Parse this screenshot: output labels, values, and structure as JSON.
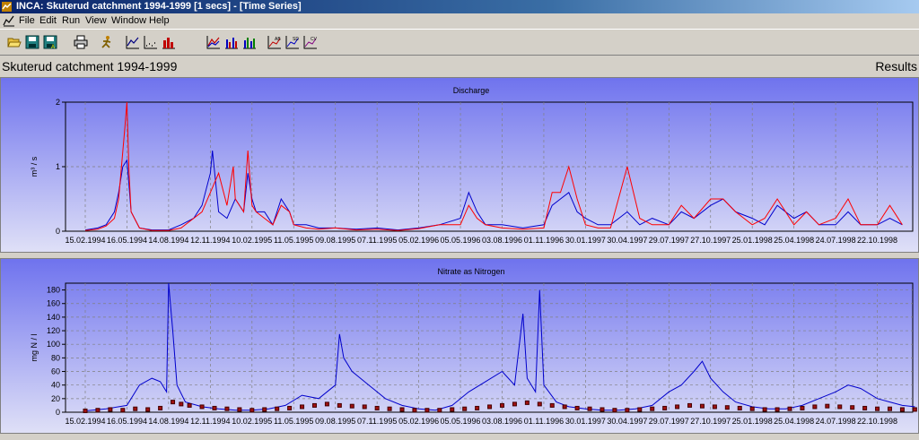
{
  "window": {
    "title": "INCA: Skuterud catchment 1994-1999 [1 secs] - [Time Series]",
    "icon": "inca-app-icon"
  },
  "menu": {
    "items": [
      "File",
      "Edit",
      "Run",
      "View",
      "Window",
      "Help"
    ]
  },
  "toolbar": {
    "buttons": [
      "open-folder-icon",
      "save-icon",
      "save-all-icon",
      "print-icon",
      "run-icon",
      "line-chart-icon",
      "dotted-chart-icon",
      "bar-chart-icon",
      "chart-zoom-icon",
      "chart-bars-icon",
      "chart-bars-color-icon",
      "chart-stats-icon",
      "chart-stats-2-icon",
      "chart-stats-3-icon"
    ]
  },
  "header": {
    "title": "Skuterud catchment 1994-1999",
    "right_label": "Results"
  },
  "colors": {
    "plot_top": "#6f73ee",
    "plot_bottom": "#dfe0f7",
    "series_blue": "#0000cc",
    "series_red": "#ff0000",
    "marker": "#a01010"
  },
  "chart_data": [
    {
      "type": "line",
      "title": "Discharge",
      "ylabel": "m³ / s",
      "xlabel": "",
      "ylim": [
        0,
        2
      ],
      "yticks": [
        "0",
        "1",
        "2"
      ],
      "x_tick_labels": [
        "15.02.1994",
        "16.05.1994",
        "14.08.1994",
        "12.11.1994",
        "10.02.1995",
        "11.05.1995",
        "09.08.1995",
        "07.11.1995",
        "05.02.1996",
        "05.05.1996",
        "03.08.1996",
        "01.11.1996",
        "30.01.1997",
        "30.04.1997",
        "29.07.1997",
        "27.10.1997",
        "25.01.1998",
        "25.04.1998",
        "24.07.1998",
        "22.10.1998"
      ],
      "grid": true,
      "series": [
        {
          "color": "blue",
          "x_index": [
            0,
            0.3,
            0.5,
            0.7,
            0.8,
            0.9,
            1.0,
            1.05,
            1.1,
            1.3,
            1.6,
            2.0,
            2.3,
            2.6,
            2.8,
            3.0,
            3.05,
            3.2,
            3.4,
            3.6,
            3.8,
            3.9,
            4.0,
            4.1,
            4.3,
            4.5,
            4.7,
            4.9,
            5.0,
            5.3,
            5.6,
            6.0,
            6.5,
            7.0,
            7.5,
            8.0,
            8.5,
            9.0,
            9.2,
            9.4,
            9.6,
            10.0,
            10.5,
            11.0,
            11.2,
            11.4,
            11.6,
            11.8,
            12.0,
            12.3,
            12.6,
            13.0,
            13.3,
            13.6,
            14.0,
            14.3,
            14.6,
            15.0,
            15.3,
            15.6,
            16.0,
            16.3,
            16.6,
            17.0,
            17.3,
            17.6,
            18.0,
            18.3,
            18.6,
            19.0,
            19.3,
            19.6
          ],
          "y": [
            0.02,
            0.05,
            0.1,
            0.3,
            0.6,
            1.0,
            1.1,
            0.7,
            0.3,
            0.05,
            0.02,
            0.02,
            0.1,
            0.2,
            0.4,
            0.9,
            1.25,
            0.3,
            0.2,
            0.5,
            0.3,
            0.9,
            0.5,
            0.3,
            0.3,
            0.1,
            0.5,
            0.3,
            0.1,
            0.1,
            0.05,
            0.05,
            0.03,
            0.05,
            0.02,
            0.05,
            0.1,
            0.2,
            0.6,
            0.3,
            0.1,
            0.1,
            0.05,
            0.1,
            0.4,
            0.5,
            0.6,
            0.3,
            0.2,
            0.1,
            0.1,
            0.3,
            0.1,
            0.2,
            0.1,
            0.3,
            0.2,
            0.4,
            0.5,
            0.3,
            0.2,
            0.1,
            0.4,
            0.2,
            0.3,
            0.1,
            0.1,
            0.3,
            0.1,
            0.1,
            0.2,
            0.1
          ]
        },
        {
          "color": "red",
          "x_index": [
            0,
            0.3,
            0.5,
            0.7,
            0.8,
            0.95,
            1.0,
            1.05,
            1.1,
            1.3,
            1.6,
            2.0,
            2.3,
            2.6,
            2.8,
            3.0,
            3.2,
            3.4,
            3.55,
            3.6,
            3.8,
            3.9,
            4.0,
            4.1,
            4.3,
            4.5,
            4.7,
            4.9,
            5.0,
            5.3,
            5.6,
            6.0,
            6.5,
            7.0,
            7.5,
            8.0,
            8.5,
            9.0,
            9.2,
            9.4,
            9.6,
            10.0,
            10.5,
            11.0,
            11.2,
            11.4,
            11.6,
            11.8,
            12.0,
            12.3,
            12.6,
            13.0,
            13.3,
            13.6,
            14.0,
            14.3,
            14.6,
            15.0,
            15.3,
            15.6,
            16.0,
            16.3,
            16.6,
            17.0,
            17.3,
            17.6,
            18.0,
            18.3,
            18.6,
            19.0,
            19.3,
            19.6
          ],
          "y": [
            0.01,
            0.03,
            0.08,
            0.2,
            0.5,
            1.6,
            2.0,
            0.9,
            0.3,
            0.05,
            0.01,
            0.01,
            0.05,
            0.2,
            0.3,
            0.6,
            0.9,
            0.4,
            1.0,
            0.5,
            0.3,
            1.25,
            0.4,
            0.3,
            0.2,
            0.1,
            0.4,
            0.3,
            0.1,
            0.05,
            0.03,
            0.05,
            0.02,
            0.03,
            0.01,
            0.04,
            0.1,
            0.1,
            0.4,
            0.2,
            0.1,
            0.05,
            0.03,
            0.05,
            0.6,
            0.6,
            1.0,
            0.5,
            0.1,
            0.05,
            0.05,
            1.0,
            0.2,
            0.1,
            0.1,
            0.4,
            0.2,
            0.5,
            0.5,
            0.3,
            0.1,
            0.2,
            0.5,
            0.1,
            0.3,
            0.1,
            0.2,
            0.5,
            0.1,
            0.1,
            0.4,
            0.1
          ]
        }
      ]
    },
    {
      "type": "line",
      "title": "Nitrate as Nitrogen",
      "ylabel": "mg N / l",
      "xlabel": "",
      "ylim": [
        0,
        190
      ],
      "yticks": [
        "0",
        "20",
        "40",
        "60",
        "80",
        "100",
        "120",
        "140",
        "160",
        "180"
      ],
      "x_tick_labels": [
        "15.02.1994",
        "16.05.1994",
        "14.08.1994",
        "12.11.1994",
        "10.02.1995",
        "11.05.1995",
        "09.08.1995",
        "07.11.1995",
        "05.02.1996",
        "05.05.1996",
        "03.08.1996",
        "01.11.1996",
        "30.01.1997",
        "30.04.1997",
        "29.07.1997",
        "27.10.1997",
        "25.01.1998",
        "25.04.1998",
        "24.07.1998",
        "22.10.1998"
      ],
      "grid": true,
      "series": [
        {
          "color": "blue",
          "x_index": [
            0,
            0.5,
            1.0,
            1.3,
            1.6,
            1.8,
            1.95,
            2.0,
            2.1,
            2.2,
            2.4,
            2.8,
            3.2,
            3.6,
            4.0,
            4.4,
            4.8,
            5.2,
            5.6,
            6.0,
            6.1,
            6.2,
            6.4,
            6.6,
            6.8,
            7.0,
            7.2,
            7.6,
            8.0,
            8.4,
            8.8,
            9.2,
            9.6,
            10.0,
            10.3,
            10.5,
            10.6,
            10.8,
            10.9,
            11.0,
            11.3,
            11.6,
            12.0,
            12.4,
            12.8,
            13.2,
            13.6,
            14.0,
            14.3,
            14.6,
            14.8,
            15.0,
            15.3,
            15.6,
            16.0,
            16.4,
            16.8,
            17.2,
            17.6,
            18.0,
            18.3,
            18.6,
            19.0,
            19.3,
            19.6,
            19.9
          ],
          "y": [
            2,
            5,
            10,
            40,
            50,
            45,
            30,
            190,
            120,
            40,
            15,
            8,
            5,
            3,
            3,
            5,
            10,
            25,
            20,
            40,
            115,
            80,
            60,
            50,
            40,
            30,
            20,
            10,
            5,
            3,
            10,
            30,
            45,
            60,
            40,
            145,
            50,
            30,
            180,
            40,
            15,
            8,
            5,
            3,
            3,
            5,
            10,
            30,
            40,
            60,
            75,
            50,
            30,
            15,
            8,
            5,
            5,
            10,
            20,
            30,
            40,
            35,
            20,
            15,
            10,
            8
          ]
        }
      ],
      "markers": {
        "color": "dark-red",
        "x_index": [
          0,
          0.3,
          0.6,
          0.9,
          1.2,
          1.5,
          1.8,
          2.1,
          2.3,
          2.5,
          2.8,
          3.1,
          3.4,
          3.7,
          4.0,
          4.3,
          4.6,
          4.9,
          5.2,
          5.5,
          5.8,
          6.1,
          6.4,
          6.7,
          7.0,
          7.3,
          7.6,
          7.9,
          8.2,
          8.5,
          8.8,
          9.1,
          9.4,
          9.7,
          10.0,
          10.3,
          10.6,
          10.9,
          11.2,
          11.5,
          11.8,
          12.1,
          12.4,
          12.7,
          13.0,
          13.3,
          13.6,
          13.9,
          14.2,
          14.5,
          14.8,
          15.1,
          15.4,
          15.7,
          16.0,
          16.3,
          16.6,
          16.9,
          17.2,
          17.5,
          17.8,
          18.1,
          18.4,
          18.7,
          19.0,
          19.3,
          19.6,
          19.9
        ],
        "y": [
          2,
          3,
          4,
          3,
          5,
          4,
          6,
          15,
          12,
          10,
          8,
          6,
          5,
          4,
          3,
          4,
          5,
          6,
          8,
          10,
          12,
          10,
          9,
          8,
          6,
          5,
          4,
          3,
          3,
          3,
          4,
          5,
          6,
          8,
          10,
          12,
          14,
          12,
          10,
          8,
          6,
          5,
          4,
          3,
          3,
          4,
          5,
          6,
          8,
          10,
          9,
          8,
          7,
          6,
          5,
          4,
          4,
          5,
          6,
          8,
          9,
          8,
          7,
          6,
          5,
          5,
          4,
          4
        ]
      }
    }
  ]
}
